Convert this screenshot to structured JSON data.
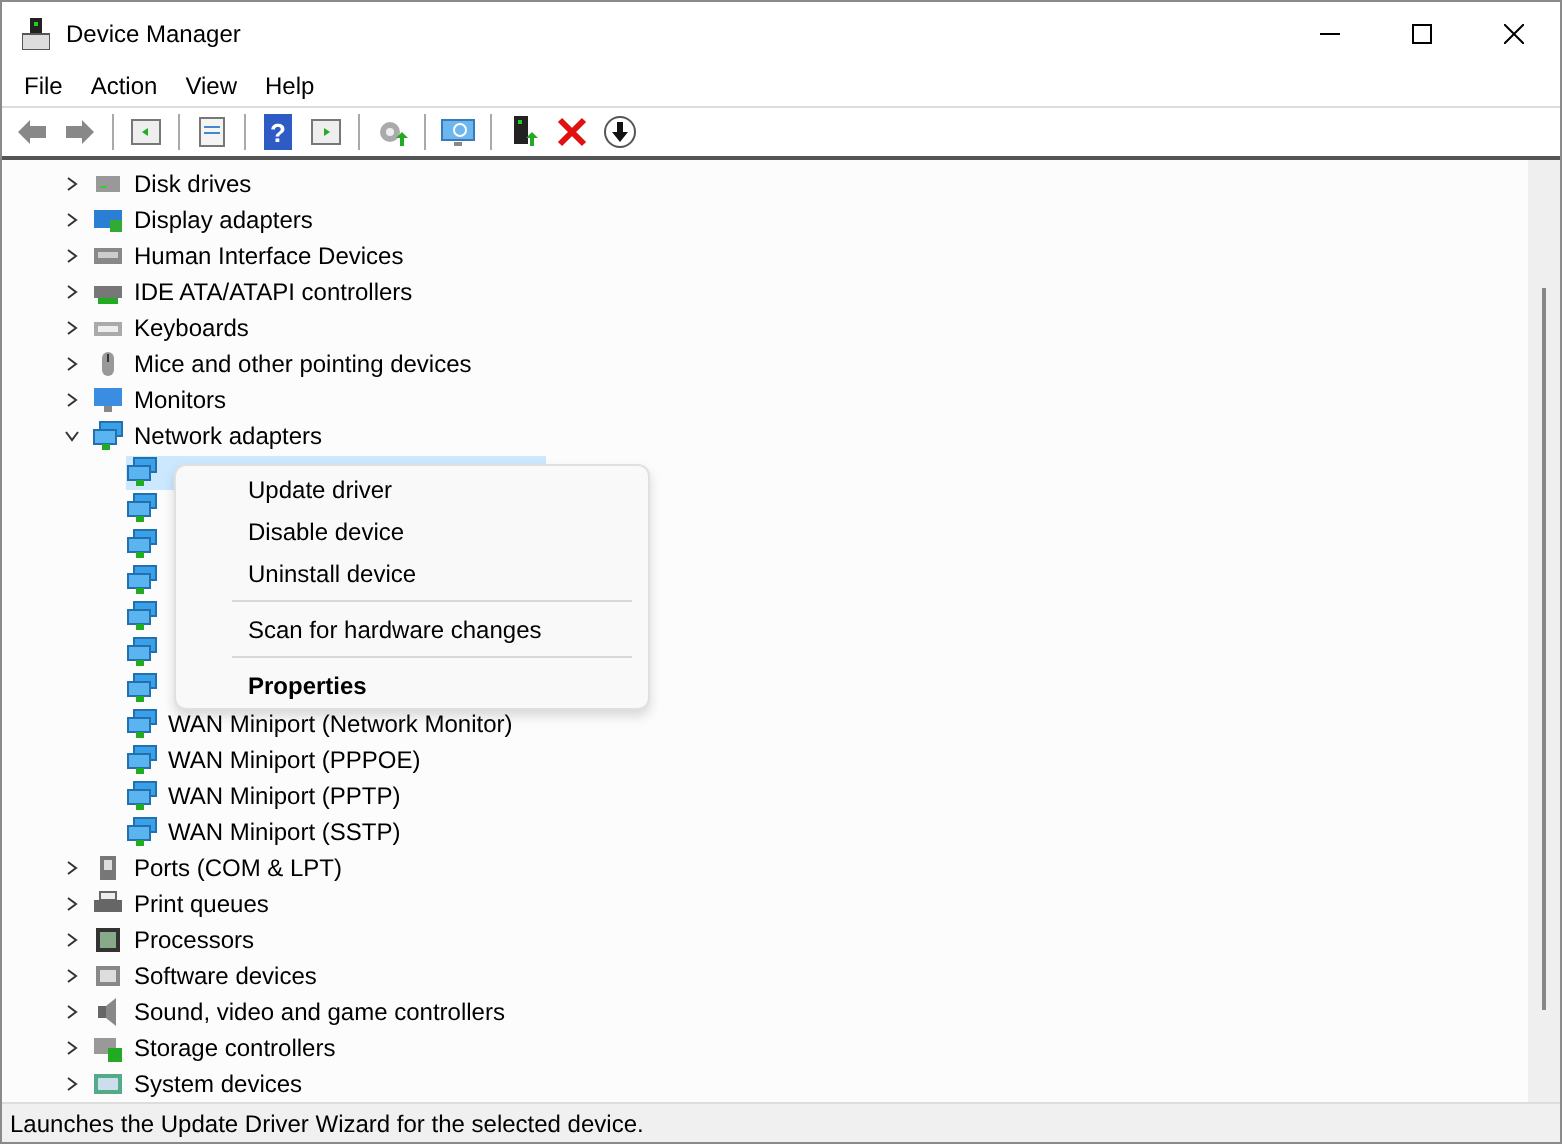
{
  "window": {
    "title": "Device Manager"
  },
  "menu": [
    "File",
    "Action",
    "View",
    "Help"
  ],
  "toolbar": [
    {
      "kind": "back"
    },
    {
      "kind": "forward"
    },
    {
      "kind": "separator"
    },
    {
      "kind": "tree"
    },
    {
      "kind": "separator"
    },
    {
      "kind": "properties"
    },
    {
      "kind": "separator"
    },
    {
      "kind": "help",
      "glyph": "?"
    },
    {
      "kind": "pane"
    },
    {
      "kind": "separator"
    },
    {
      "kind": "scan"
    },
    {
      "kind": "separator"
    },
    {
      "kind": "monitor"
    },
    {
      "kind": "separator"
    },
    {
      "kind": "update"
    },
    {
      "kind": "uninstall"
    },
    {
      "kind": "download"
    }
  ],
  "tree": [
    {
      "label": "Disk drives",
      "kind": "disk",
      "expanded": false
    },
    {
      "label": "Display adapters",
      "kind": "display",
      "expanded": false
    },
    {
      "label": "Human Interface Devices",
      "kind": "hid",
      "expanded": false
    },
    {
      "label": "IDE ATA/ATAPI controllers",
      "kind": "ide",
      "expanded": false
    },
    {
      "label": "Keyboards",
      "kind": "keyboard",
      "expanded": false
    },
    {
      "label": "Mice and other pointing devices",
      "kind": "mouse",
      "expanded": false
    },
    {
      "label": "Monitors",
      "kind": "monitor",
      "expanded": false
    },
    {
      "label": "Network adapters",
      "kind": "network",
      "expanded": true,
      "children": [
        {
          "kind": "network",
          "selected": true
        },
        {
          "kind": "network",
          "selected": false
        },
        {
          "kind": "network",
          "selected": false
        },
        {
          "kind": "network",
          "selected": false
        },
        {
          "kind": "network",
          "selected": false
        },
        {
          "kind": "network",
          "selected": false
        },
        {
          "kind": "network",
          "selected": false
        },
        {
          "label": "WAN Miniport (Network Monitor)",
          "kind": "network",
          "selected": false
        },
        {
          "label": "WAN Miniport (PPPOE)",
          "kind": "network",
          "selected": false
        },
        {
          "label": "WAN Miniport (PPTP)",
          "kind": "network",
          "selected": false
        },
        {
          "label": "WAN Miniport (SSTP)",
          "kind": "network",
          "selected": false
        }
      ]
    },
    {
      "label": "Ports (COM & LPT)",
      "kind": "ports",
      "expanded": false
    },
    {
      "label": "Print queues",
      "kind": "printer",
      "expanded": false
    },
    {
      "label": "Processors",
      "kind": "processor",
      "expanded": false
    },
    {
      "label": "Software devices",
      "kind": "software",
      "expanded": false
    },
    {
      "label": "Sound, video and game controllers",
      "kind": "sound",
      "expanded": false
    },
    {
      "label": "Storage controllers",
      "kind": "storage",
      "expanded": false
    },
    {
      "label": "System devices",
      "kind": "system",
      "expanded": false
    }
  ],
  "context_menu": [
    {
      "kind": "item",
      "label": "Update driver"
    },
    {
      "kind": "item",
      "label": "Disable device"
    },
    {
      "kind": "item",
      "label": "Uninstall device"
    },
    {
      "kind": "separator"
    },
    {
      "kind": "item",
      "label": "Scan for hardware changes"
    },
    {
      "kind": "separator"
    },
    {
      "kind": "bold",
      "label": "Properties"
    }
  ],
  "status_bar": "Launches the Update Driver Wizard for the selected device."
}
